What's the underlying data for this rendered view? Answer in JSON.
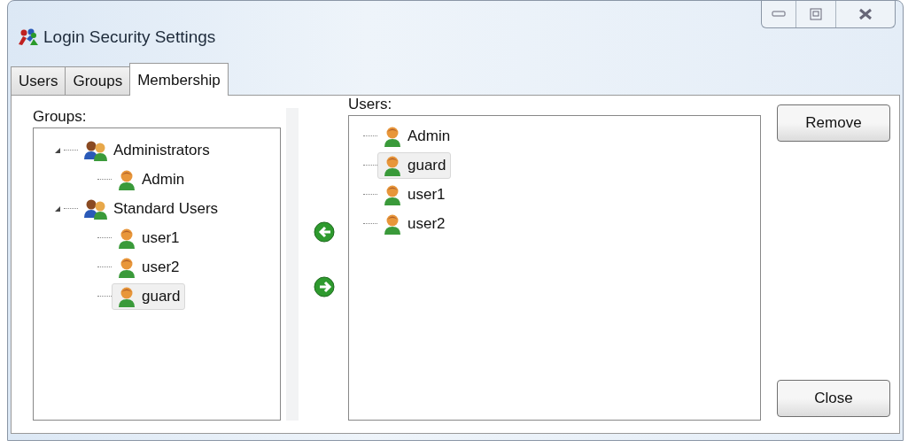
{
  "window": {
    "title": "Login Security Settings"
  },
  "tabs": [
    {
      "label": "Users",
      "selected": false
    },
    {
      "label": "Groups",
      "selected": false
    },
    {
      "label": "Membership",
      "selected": true
    }
  ],
  "groups_panel": {
    "label": "Groups:",
    "tree": [
      {
        "label": "Administrators",
        "kind": "group",
        "expanded": true,
        "selected": false,
        "children": [
          {
            "label": "Admin",
            "kind": "user",
            "selected": false
          }
        ]
      },
      {
        "label": "Standard Users",
        "kind": "group",
        "expanded": true,
        "selected": false,
        "children": [
          {
            "label": "user1",
            "kind": "user",
            "selected": false
          },
          {
            "label": "user2",
            "kind": "user",
            "selected": false
          },
          {
            "label": "guard",
            "kind": "user",
            "selected": true
          }
        ]
      }
    ]
  },
  "users_panel": {
    "label": "Users:",
    "items": [
      {
        "label": "Admin",
        "selected": false
      },
      {
        "label": "guard",
        "selected": true
      },
      {
        "label": "user1",
        "selected": false
      },
      {
        "label": "user2",
        "selected": false
      }
    ]
  },
  "buttons": [
    "Remove",
    "Close"
  ]
}
